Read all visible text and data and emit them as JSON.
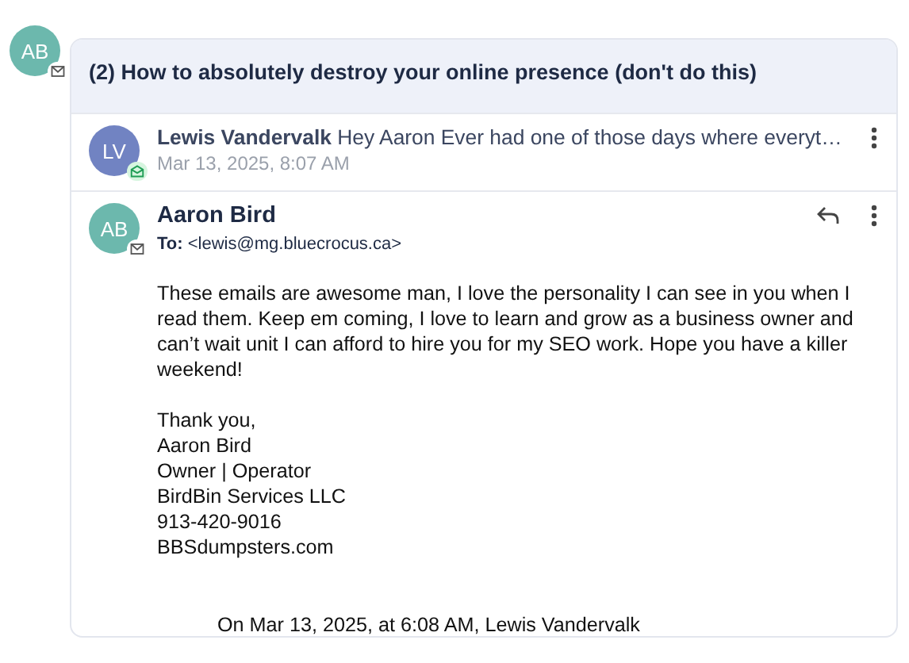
{
  "thread": {
    "avatar_initials": "AB",
    "subject": "(2) How to absolutely destroy your online presence (don't do this)"
  },
  "messages": [
    {
      "kind": "collapsed",
      "avatar_initials": "LV",
      "color": "#7183c2",
      "sender": "Lewis Vandervalk",
      "snippet": "Hey Aaron Ever had one of those days where everyt…",
      "date": "Mar 13, 2025, 8:07 AM"
    },
    {
      "kind": "expanded",
      "avatar_initials": "AB",
      "color": "#6cb8ad",
      "sender": "Aaron Bird",
      "to_label": "To:",
      "to": "<lewis@mg.bluecrocus.ca>",
      "body": "These emails are awesome man, I love the personality I can see in you when I read them. Keep em coming, I love to learn and grow as a business owner and can’t wait unit I can afford to hire you for my SEO work. Hope you have a killer weekend!",
      "signature": [
        "Thank you,",
        "Aaron Bird",
        "Owner | Operator",
        "BirdBin Services LLC",
        "913-420-9016",
        "BBSdumpsters.com"
      ],
      "quote_intro": "On Mar 13, 2025, at 6:08 AM, Lewis Vandervalk"
    }
  ]
}
